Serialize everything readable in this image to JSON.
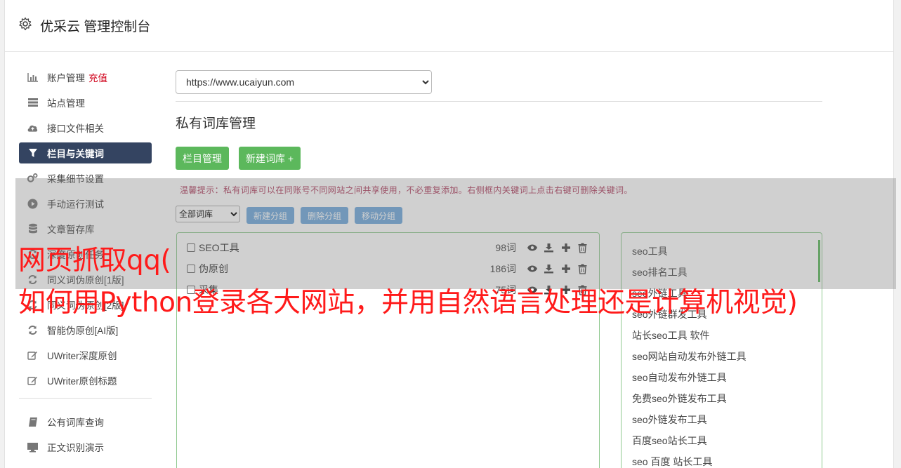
{
  "header": {
    "title": "优采云 管理控制台",
    "icon": "gear-icon"
  },
  "sidebar": {
    "items": [
      {
        "label": "账户管理",
        "icon": "bar-chart-icon",
        "extra": "充值"
      },
      {
        "label": "站点管理",
        "icon": "server-icon"
      },
      {
        "label": "接口文件相关",
        "icon": "cloud-upload-icon"
      },
      {
        "label": "栏目与关键词",
        "icon": "filter-icon",
        "active": true
      },
      {
        "label": "采集细节设置",
        "icon": "gears-icon"
      },
      {
        "label": "手动运行测试",
        "icon": "play-circle-icon"
      },
      {
        "label": "文章暂存库",
        "icon": "database-icon"
      },
      {
        "label": "深度原创任务",
        "icon": "refresh-icon"
      },
      {
        "label": "同义词伪原创[1版]",
        "icon": "refresh-icon"
      },
      {
        "label": "同义词伪原创[2版]",
        "icon": "refresh-icon"
      },
      {
        "label": "智能伪原创[AI版]",
        "icon": "refresh-icon"
      },
      {
        "label": "UWriter深度原创",
        "icon": "edit-icon"
      },
      {
        "label": "UWriter原创标题",
        "icon": "edit-icon"
      }
    ],
    "items2": [
      {
        "label": "公有词库查询",
        "icon": "book-icon"
      },
      {
        "label": "正文识别演示",
        "icon": "monitor-icon"
      }
    ]
  },
  "main": {
    "site_select": "https://www.ucaiyun.com",
    "section_title": "私有词库管理",
    "btn_columns": "栏目管理",
    "btn_new_lib": "新建词库 +",
    "tip": "温馨提示：私有词库可以在同账号不同网站之间共享使用，不必重复添加。右侧框内关键词上点击右键可删除关键词。",
    "group_select": "全部词库",
    "btn_new_group": "新建分组",
    "btn_delete_group": "删除分组",
    "btn_move_group": "移动分组",
    "libraries": [
      {
        "name": "SEO工具",
        "count": "98词"
      },
      {
        "name": "伪原创",
        "count": "186词"
      },
      {
        "name": "采集",
        "count": "75词"
      }
    ],
    "keywords": [
      "seo工具",
      "seo排名工具",
      "seo外链工具",
      "seo外链群发工具",
      "站长seo工具 软件",
      "seo网站自动发布外链工具",
      "seo自动发布外链工具",
      "免费seo外链发布工具",
      "seo外链发布工具",
      "百度seo站长工具",
      "seo 百度 站长工具"
    ]
  },
  "overlay": {
    "line1": "网页抓取qq(",
    "line2": "如何用Python登录各大网站，并用自然语言处理还是计算机视觉)"
  },
  "colors": {
    "active_nav": "#344461",
    "green": "#5cb85c",
    "blue": "#6fa8dc",
    "headline": "#ff1a1a",
    "recharge": "#d0021b"
  }
}
